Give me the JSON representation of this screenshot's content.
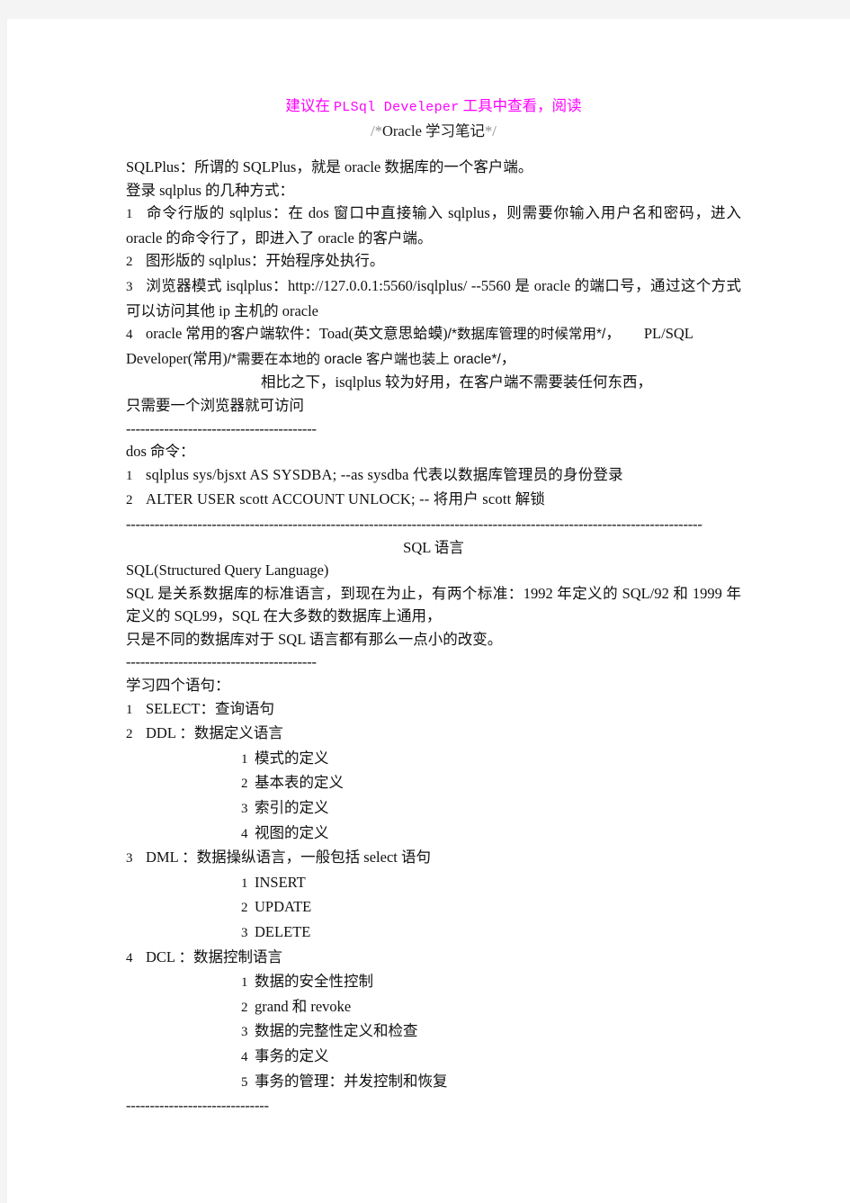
{
  "document": {
    "title_note": {
      "prefix_cn": "建议在 ",
      "mono": "PLSql Develeper",
      "suffix_cn": "  工具中查看，阅读",
      "color": "#ff00ff"
    },
    "subtitle": {
      "open": "/*",
      "text": "Oracle 学习笔记",
      "close": "*/",
      "comment_color": "#8a8a8a"
    },
    "body": {
      "p1": "SQLPlus：所谓的 SQLPlus，就是 oracle 数据库的一个客户端。",
      "p2": "登录 sqlplus 的几种方式：",
      "item1_num": "1",
      "item1": "命令行版的 sqlplus：在 dos 窗口中直接输入 sqlplus，则需要你输入用户名和密码，进入 oracle 的命令行了，即进入了 oracle 的客户端。",
      "item2_num": "2",
      "item2": "图形版的 sqlplus：开始程序处执行。",
      "item3_num": "3",
      "item3": "浏览器模式 isqlplus：http://127.0.0.1:5560/isqlplus/   --5560 是 oracle 的端口号，通过这个方式可以访问其他 ip 主机的 oracle",
      "item4_num": "4",
      "item4_a": "oracle  常用的客户端软件：Toad(英文意思蛤蟆)",
      "item4_cmt1": "/*数据库管理的时候常用*/",
      "item4_b": "，",
      "item4_c": "PL/SQL Developer(常用)",
      "item4_cmt2": "/*需要在本地的 oracle 客户端也装上 oracle*/",
      "item4_d": "，",
      "item4_tail1": "相比之下，isqlplus 较为好用，在客户端不需要装任何东西，",
      "item4_tail2": "只需要一个浏览器就可访问",
      "sep1": "----------------------------------------",
      "dos_heading": "dos 命令：",
      "dos1_num": "1",
      "dos1": "sqlplus    sys/bjsxt AS SYSDBA; --as sysdba 代表以数据库管理员的身份登录",
      "dos2_num": "2",
      "dos2": "ALTER USER scott ACCOUNT UNLOCK; -- 将用户 scott 解锁",
      "sep2_long": "-------------------------------------------------------------------------------------------------------------------------",
      "sql_heading": "SQL 语言",
      "sql_full_name": "SQL(Structured Query Language)",
      "sql_desc1": "SQL 是关系数据库的标准语言，到现在为止，有两个标准：1992 年定义的 SQL/92 和 1999 年定义的 SQL99，SQL 在大多数的数据库上通用，",
      "sql_desc2": "只是不同的数据库对于 SQL 语言都有那么一点小的改变。",
      "sep3": "----------------------------------------",
      "learn_heading": "学习四个语句：",
      "s1_num": "1",
      "s1": "SELECT：查询语句",
      "s2_num": "2",
      "s2": "DDL  ：数据定义语言",
      "s2_subs": [
        {
          "n": "1",
          "t": "模式的定义"
        },
        {
          "n": "2",
          "t": "基本表的定义"
        },
        {
          "n": "3",
          "t": "索引的定义"
        },
        {
          "n": "4",
          "t": "视图的定义"
        }
      ],
      "s3_num": "3",
      "s3": "DML  ：数据操纵语言，一般包括 select 语句",
      "s3_subs": [
        {
          "n": "1",
          "t": "INSERT"
        },
        {
          "n": "2",
          "t": "UPDATE"
        },
        {
          "n": "3",
          "t": "DELETE"
        }
      ],
      "s4_num": "4",
      "s4": "DCL  ：数据控制语言",
      "s4_subs": [
        {
          "n": "1",
          "t": "数据的安全性控制"
        },
        {
          "n": "2",
          "t": "grand 和 revoke"
        },
        {
          "n": "3",
          "t": "数据的完整性定义和检查"
        },
        {
          "n": "4",
          "t": "事务的定义"
        },
        {
          "n": "5",
          "t": "事务的管理：并发控制和恢复"
        }
      ],
      "sep4": "------------------------------"
    }
  }
}
